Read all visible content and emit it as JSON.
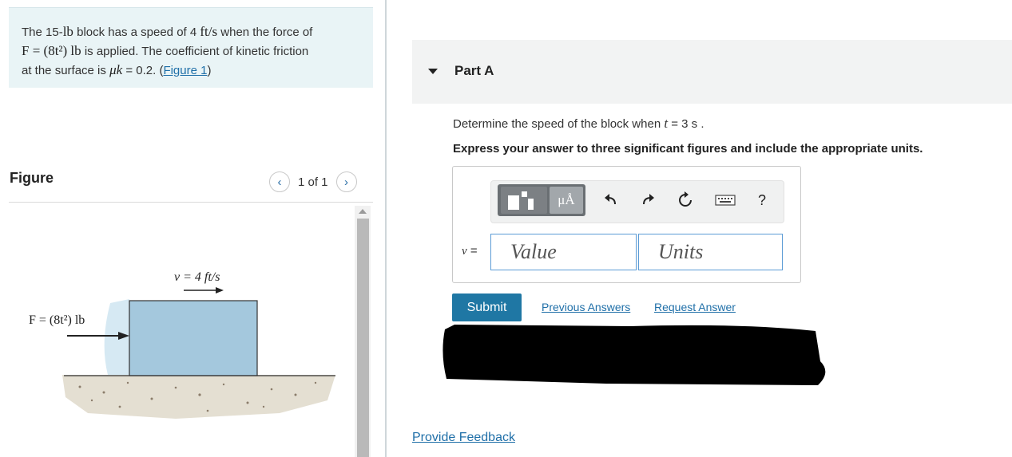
{
  "problem": {
    "text_1": "The 15-",
    "weight": "lb",
    "text_2": " block has a speed of 4 ",
    "speed_unit": "ft/s",
    "text_3": " when the force of",
    "force_eq": "F = (8t²) lb",
    "text_4": " is applied. The coefficient of kinetic friction",
    "text_5": "at the surface is ",
    "mu": "μk",
    "text_6": " = 0.2. (",
    "figure_link": "Figure 1",
    "text_7": ")"
  },
  "figure": {
    "heading": "Figure",
    "counter": "1 of 1",
    "prev_icon": "chevron-left-icon",
    "next_icon": "chevron-right-icon",
    "velocity_label": "v = 4 ft/s",
    "force_label": "F = (8t²) lb",
    "block_color": "#a4c8dd"
  },
  "part": {
    "title": "Part A",
    "question_1": "Determine the speed of the block when ",
    "question_var": "t",
    "question_2": " = 3  s .",
    "instruction": "Express your answer to three significant figures and include the appropriate units."
  },
  "toolbar": {
    "mu_label": "μÅ",
    "undo_icon": "undo-icon",
    "redo_icon": "redo-icon",
    "reset_icon": "reset-icon",
    "keyboard_icon": "keyboard-icon",
    "help_label": "?"
  },
  "answer": {
    "var_label": "v",
    "equals": " =",
    "value_placeholder": "Value",
    "units_placeholder": "Units"
  },
  "actions": {
    "submit_label": "Submit",
    "previous_answers": "Previous Answers",
    "request_answer": "Request Answer",
    "provide_feedback": "Provide Feedback"
  },
  "colors": {
    "accent": "#1f77a4",
    "link": "#1f6fa8",
    "problem_bg": "#e9f4f6"
  }
}
